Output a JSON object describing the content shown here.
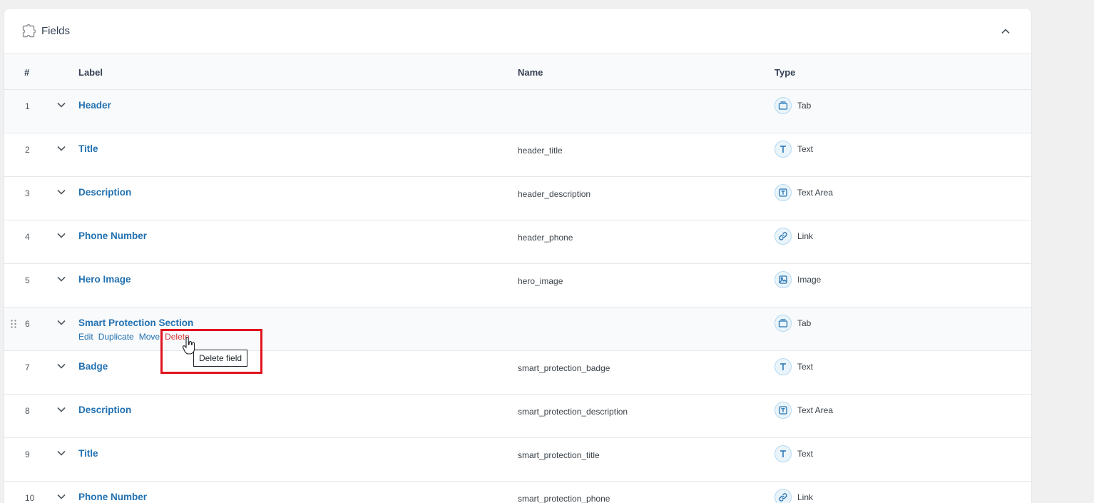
{
  "panel": {
    "title": "Fields",
    "icon": "puzzle-icon",
    "collapse_icon": "chevron-up-icon"
  },
  "columns": {
    "num": "#",
    "label": "Label",
    "name": "Name",
    "type": "Type"
  },
  "rows": [
    {
      "num": "1",
      "label": "Header",
      "name": "",
      "type": "Tab",
      "type_icon": "tab-icon"
    },
    {
      "num": "2",
      "label": "Title",
      "name": "header_title",
      "type": "Text",
      "type_icon": "text-icon"
    },
    {
      "num": "3",
      "label": "Description",
      "name": "header_description",
      "type": "Text Area",
      "type_icon": "textarea-icon"
    },
    {
      "num": "4",
      "label": "Phone Number",
      "name": "header_phone",
      "type": "Link",
      "type_icon": "link-icon"
    },
    {
      "num": "5",
      "label": "Hero Image",
      "name": "hero_image",
      "type": "Image",
      "type_icon": "image-icon"
    },
    {
      "num": "6",
      "label": "Smart Protection Section",
      "name": "",
      "type": "Tab",
      "type_icon": "tab-icon"
    },
    {
      "num": "7",
      "label": "Badge",
      "name": "smart_protection_badge",
      "type": "Text",
      "type_icon": "text-icon"
    },
    {
      "num": "8",
      "label": "Description",
      "name": "smart_protection_description",
      "type": "Text Area",
      "type_icon": "textarea-icon"
    },
    {
      "num": "9",
      "label": "Title",
      "name": "smart_protection_title",
      "type": "Text",
      "type_icon": "text-icon"
    },
    {
      "num": "10",
      "label": "Phone Number",
      "name": "smart_protection_phone",
      "type": "Link",
      "type_icon": "link-icon"
    }
  ],
  "row_actions": {
    "edit": "Edit",
    "duplicate": "Duplicate",
    "move": "Move",
    "delete": "Delete"
  },
  "tooltip": "Delete field",
  "colors": {
    "link": "#2271b1",
    "delete": "#d63638",
    "highlight": "#e0141e"
  }
}
